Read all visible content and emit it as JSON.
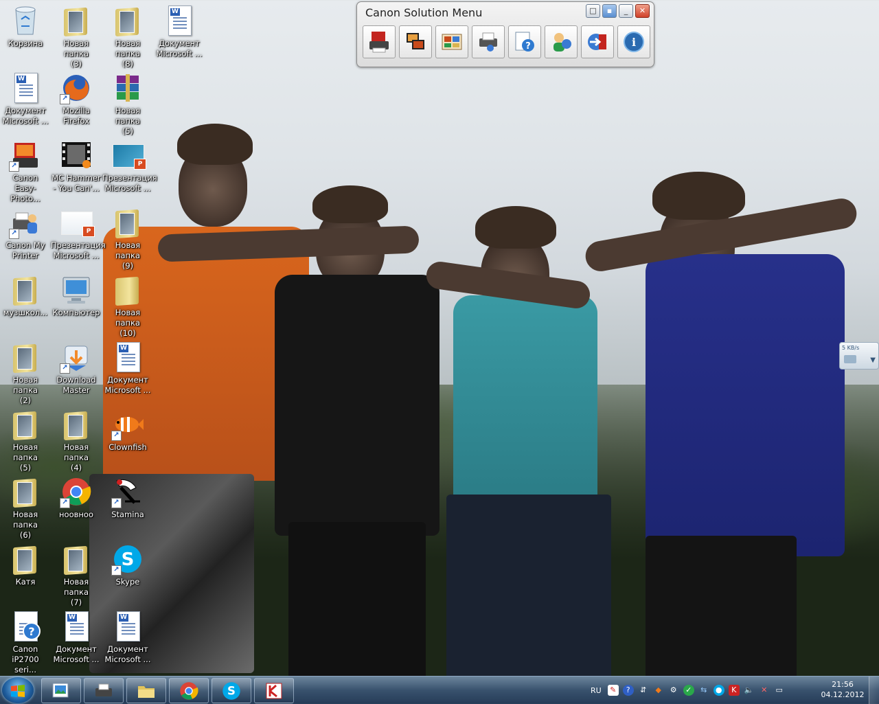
{
  "desktop": {
    "icons": [
      {
        "label": "Корзина"
      },
      {
        "label": "Новая папка\n(3)"
      },
      {
        "label": "Новая папка\n(8)"
      },
      {
        "label": "Документ\nMicrosoft ..."
      },
      {
        "label": "Документ\nMicrosoft ..."
      },
      {
        "label": "Mozilla\nFirefox"
      },
      {
        "label": "Новая папка\n(5)"
      },
      {
        "label": "Canon\nEasy-Photo..."
      },
      {
        "label": "MC Hammer\n- You Can'..."
      },
      {
        "label": "Презентация\nMicrosoft ..."
      },
      {
        "label": "Canon My\nPrinter"
      },
      {
        "label": "Презентация\nMicrosoft ..."
      },
      {
        "label": "Новая папка\n(9)"
      },
      {
        "label": "музшкол..."
      },
      {
        "label": "Компьютер"
      },
      {
        "label": "Новая папка\n(10)"
      },
      {
        "label": "Новая папка\n(2)"
      },
      {
        "label": "Download\nMaster"
      },
      {
        "label": "Документ\nMicrosoft ..."
      },
      {
        "label": "Новая папка\n(5)"
      },
      {
        "label": "Новая папка\n(4)"
      },
      {
        "label": "Clownfish"
      },
      {
        "label": "Новая папка\n(6)"
      },
      {
        "label": "ноовноо"
      },
      {
        "label": "Stamina"
      },
      {
        "label": "Катя"
      },
      {
        "label": "Новая папка\n(7)"
      },
      {
        "label": "Skype"
      },
      {
        "label": "Canon\niP2700 seri..."
      },
      {
        "label": "Документ\nMicrosoft ..."
      },
      {
        "label": "Документ\nMicrosoft ..."
      }
    ]
  },
  "canon_menu": {
    "title": "Canon Solution Menu",
    "tools": [
      "printer-photo-icon",
      "photo-print-icon",
      "album-icon",
      "printer-settings-icon",
      "help-manual-icon",
      "user-registration-icon",
      "exit-icon",
      "info-icon"
    ]
  },
  "gadget": {
    "speed": "5 KB/s"
  },
  "taskbar": {
    "language": "RU",
    "time": "21:56",
    "date": "04.12.2012"
  },
  "colors": {
    "taskbar": "#3a5572",
    "accent": "#1e5c9c",
    "close": "#d0412a"
  }
}
